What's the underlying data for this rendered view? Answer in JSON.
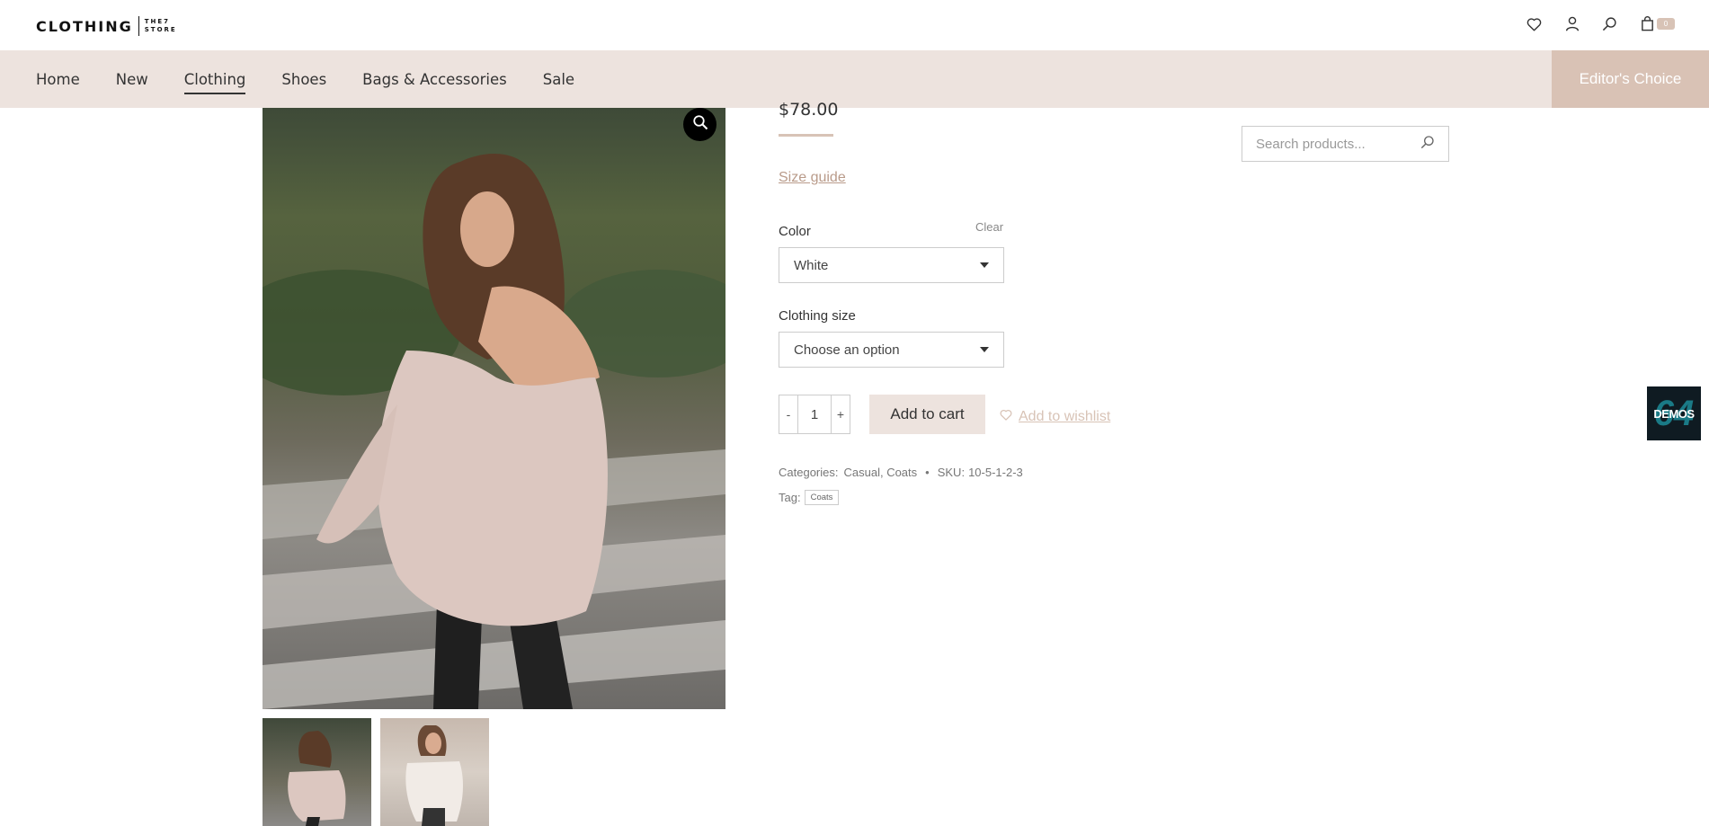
{
  "brand": {
    "main": "CLOTHING",
    "sub_top": "THE7",
    "sub_bottom": "STORE"
  },
  "header": {
    "cart_count": "0"
  },
  "nav": {
    "items": [
      {
        "label": "Home"
      },
      {
        "label": "New"
      },
      {
        "label": "Clothing",
        "active": true
      },
      {
        "label": "Shoes"
      },
      {
        "label": "Bags & Accessories"
      },
      {
        "label": "Sale"
      }
    ],
    "editors_choice": "Editor's Choice"
  },
  "product": {
    "price": "$78.00",
    "size_guide": "Size guide",
    "color_label": "Color",
    "clear_label": "Clear",
    "color_value": "White",
    "size_label": "Clothing size",
    "size_value": "Choose an option",
    "qty_minus": "-",
    "quantity": "1",
    "qty_plus": "+",
    "add_to_cart": "Add to cart",
    "add_to_wishlist": "Add to wishlist",
    "categories_label": "Categories:",
    "category_1": "Casual",
    "category_2": "Coats",
    "bullet": "•",
    "sku_label": "SKU:",
    "sku_value": "10-5-1-2-3",
    "tag_label": "Tag:",
    "tag_1": "Coats"
  },
  "search": {
    "placeholder": "Search products..."
  },
  "demos": {
    "label": "DEMOS",
    "number": "64"
  },
  "colors": {
    "accent": "#d8c3b6",
    "nav_bg": "#ede3de",
    "editors_bg": "#d9c2b5"
  },
  "icons": [
    "heart-icon",
    "user-icon",
    "search-icon",
    "bag-icon",
    "zoom-icon"
  ]
}
